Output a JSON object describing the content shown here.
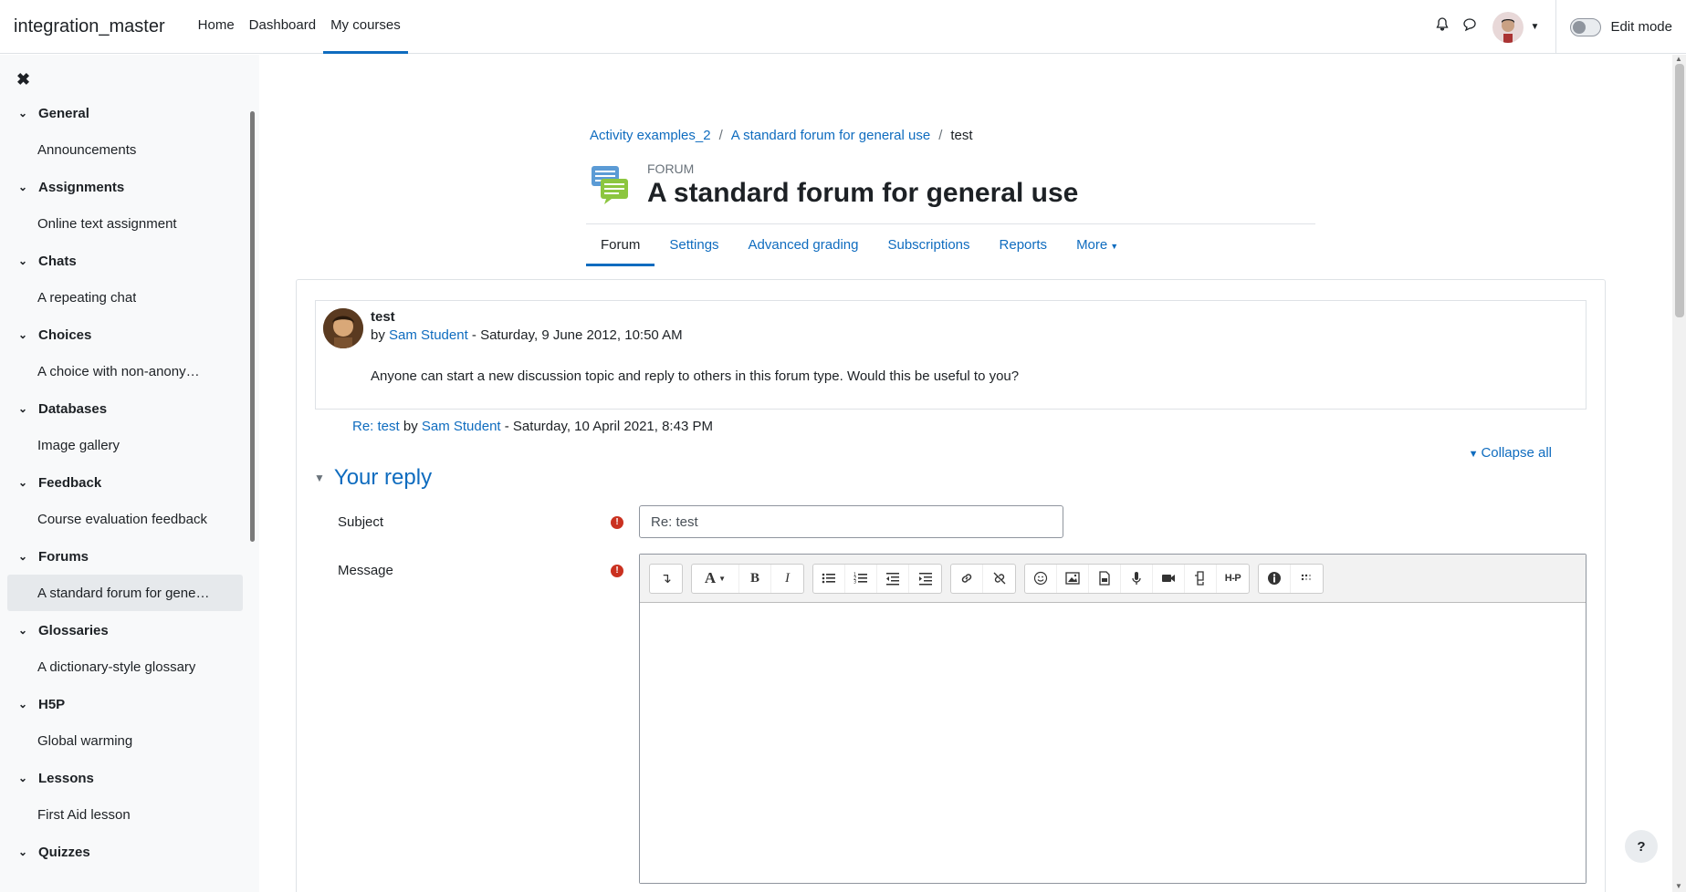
{
  "navbar": {
    "brand": "integration_master",
    "links": [
      "Home",
      "Dashboard",
      "My courses"
    ],
    "active_link": "My courses",
    "edit_mode_label": "Edit mode"
  },
  "sidebar": {
    "sections": [
      {
        "title": "General",
        "items": [
          "Announcements"
        ]
      },
      {
        "title": "Assignments",
        "items": [
          "Online text assignment"
        ]
      },
      {
        "title": "Chats",
        "items": [
          "A repeating chat"
        ]
      },
      {
        "title": "Choices",
        "items": [
          "A choice with non-anonym…"
        ]
      },
      {
        "title": "Databases",
        "items": [
          "Image gallery"
        ]
      },
      {
        "title": "Feedback",
        "items": [
          "Course evaluation feedback"
        ]
      },
      {
        "title": "Forums",
        "items": [
          "A standard forum for gene…"
        ]
      },
      {
        "title": "Glossaries",
        "items": [
          "A dictionary-style glossary"
        ]
      },
      {
        "title": "H5P",
        "items": [
          "Global warming"
        ]
      },
      {
        "title": "Lessons",
        "items": [
          "First Aid lesson"
        ]
      },
      {
        "title": "Quizzes",
        "items": []
      }
    ]
  },
  "breadcrumb": [
    "Activity examples_2",
    "A standard forum for general use",
    "test"
  ],
  "header": {
    "activity_type": "FORUM",
    "title": "A standard forum for general use"
  },
  "tabs": [
    "Forum",
    "Settings",
    "Advanced grading",
    "Subscriptions",
    "Reports",
    "More"
  ],
  "post": {
    "subject": "test",
    "by": "by",
    "author": "Sam Student",
    "date": "- Saturday, 9 June 2012, 10:50 AM",
    "body": "Anyone can start a new discussion topic and reply to others in this forum type. Would this be useful to you?"
  },
  "reply": {
    "link": "Re: test",
    "by": "by",
    "author": "Sam Student",
    "date": "- Saturday, 10 April 2021, 8:43 PM"
  },
  "form": {
    "collapse_all": "Collapse all",
    "section_title": "Your reply",
    "subject_label": "Subject",
    "subject_value": "Re: test",
    "message_label": "Message"
  },
  "help": "?",
  "colors": {
    "link": "#0f6cbf",
    "required": "#ca3120"
  }
}
